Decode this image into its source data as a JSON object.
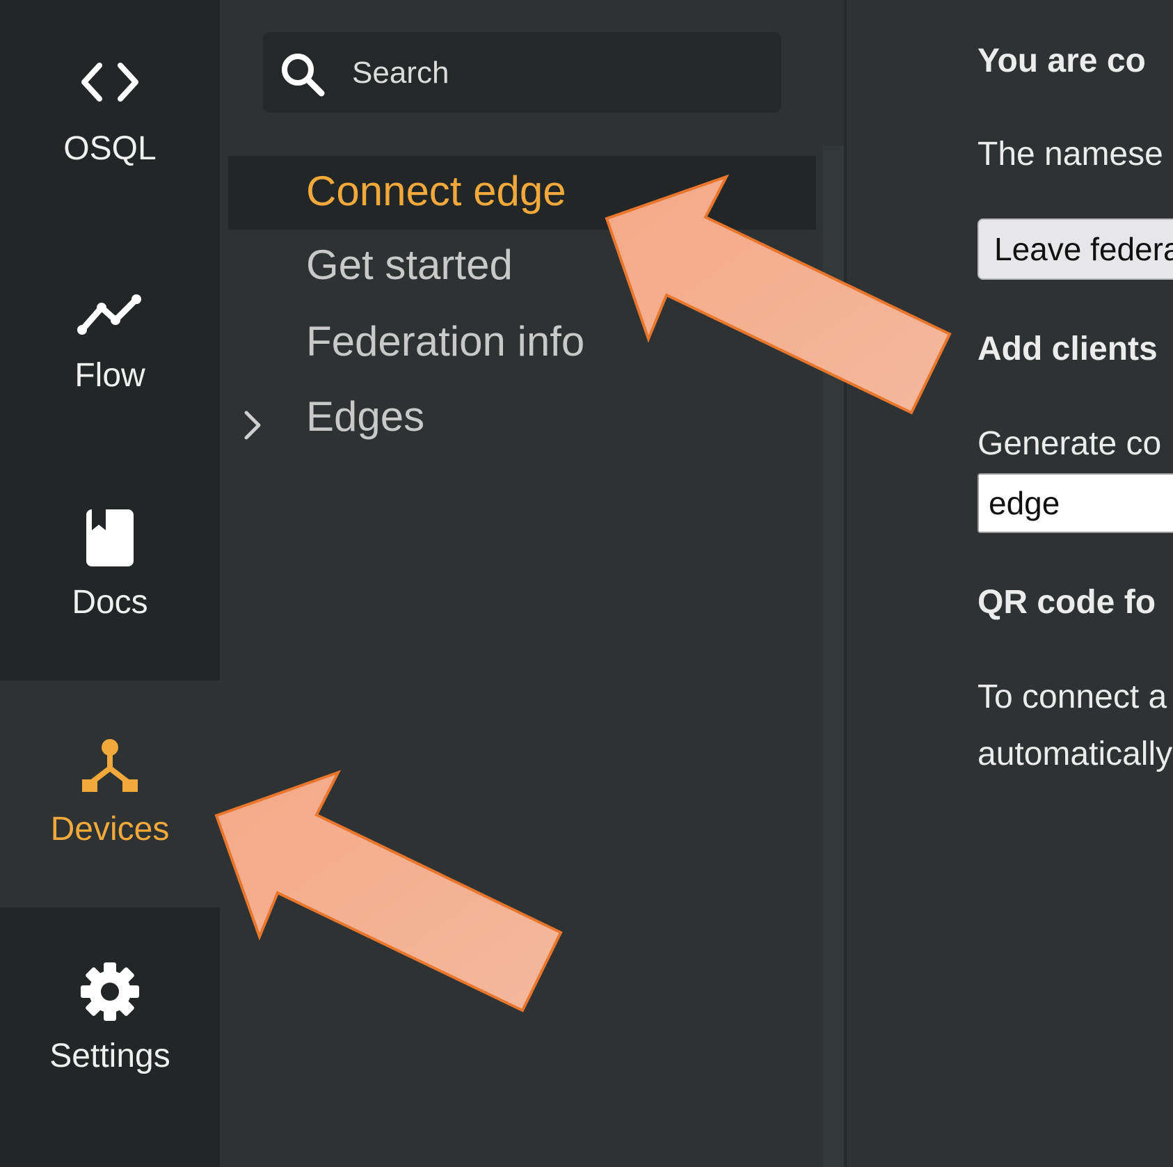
{
  "rail": {
    "items": [
      {
        "label": "OSQL",
        "icon": "code-brackets-icon"
      },
      {
        "label": "Flow",
        "icon": "line-chart-icon"
      },
      {
        "label": "Docs",
        "icon": "book-icon"
      },
      {
        "label": "Devices",
        "icon": "network-nodes-icon",
        "active": true
      },
      {
        "label": "Settings",
        "icon": "gear-icon"
      }
    ]
  },
  "tree": {
    "search_placeholder": "Search",
    "items": [
      {
        "label": "Connect edge",
        "selected": true
      },
      {
        "label": "Get started"
      },
      {
        "label": "Federation info"
      },
      {
        "label": "Edges",
        "expandable": true
      }
    ]
  },
  "content": {
    "heading_connected": "You are co",
    "namespace_text": "The namese",
    "leave_button": "Leave federa",
    "add_clients_heading": "Add clients",
    "generate_label": "Generate co",
    "name_input_value": "edge",
    "qr_heading": "QR code fo",
    "connect_text_line1": "To connect a",
    "connect_text_line2": "automatically"
  },
  "colors": {
    "accent": "#f1a93b",
    "rail_bg": "#232626",
    "panel_bg": "#2e3233",
    "annotation_fill": "#f3ad8d",
    "annotation_stroke": "#e8762d"
  }
}
